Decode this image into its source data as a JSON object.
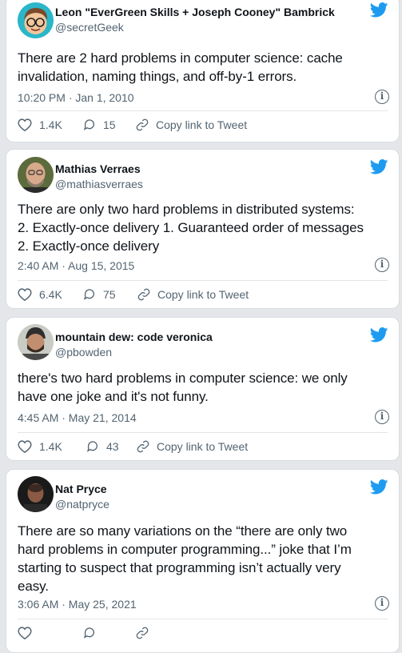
{
  "tweets": [
    {
      "name": "Leon \"EverGreen Skills + Joseph Cooney\" Bambrick",
      "handle": "@secretGeek",
      "text": "There are 2 hard problems in computer science: cache\ninvalidation, naming things, and off-by-1 errors.",
      "timestamp": "10:20 PM · Jan 1, 2010",
      "likes": "1.4K",
      "replies": "15",
      "copy_link": "Copy link to Tweet",
      "avatar_icon": "cartoon-avatar"
    },
    {
      "name": "Mathias Verraes",
      "handle": "@mathiasverraes",
      "text": "There are only two hard problems in distributed systems:\n2. Exactly-once delivery 1. Guaranteed order of messages\n2. Exactly-once delivery",
      "timestamp": "2:40 AM · Aug 15, 2015",
      "likes": "6.4K",
      "replies": "75",
      "copy_link": "Copy link to Tweet",
      "avatar_icon": "bald-man-avatar"
    },
    {
      "name": "mountain dew: code veronica",
      "handle": "@pbowden",
      "text": "there's two hard problems in computer science: we only\nhave one joke and it's not funny.",
      "timestamp": "4:45 AM · May 21, 2014",
      "likes": "1.4K",
      "replies": "43",
      "copy_link": "Copy link to Tweet",
      "avatar_icon": "beanie-man-avatar"
    },
    {
      "name": "Nat Pryce",
      "handle": "@natpryce",
      "text": "There are so many variations on the “there are only two\nhard problems in computer programming...” joke that I’m\nstarting to suspect that programming isn’t actually very\neasy.",
      "timestamp": "3:06 AM · May 25, 2021",
      "likes": "",
      "replies": "",
      "copy_link": "",
      "avatar_icon": "dark-portrait-avatar"
    }
  ],
  "colors": {
    "twitter_blue": "#1d9bf0",
    "text": "#0f1419",
    "muted": "#536471",
    "background": "#e4e6ea"
  }
}
